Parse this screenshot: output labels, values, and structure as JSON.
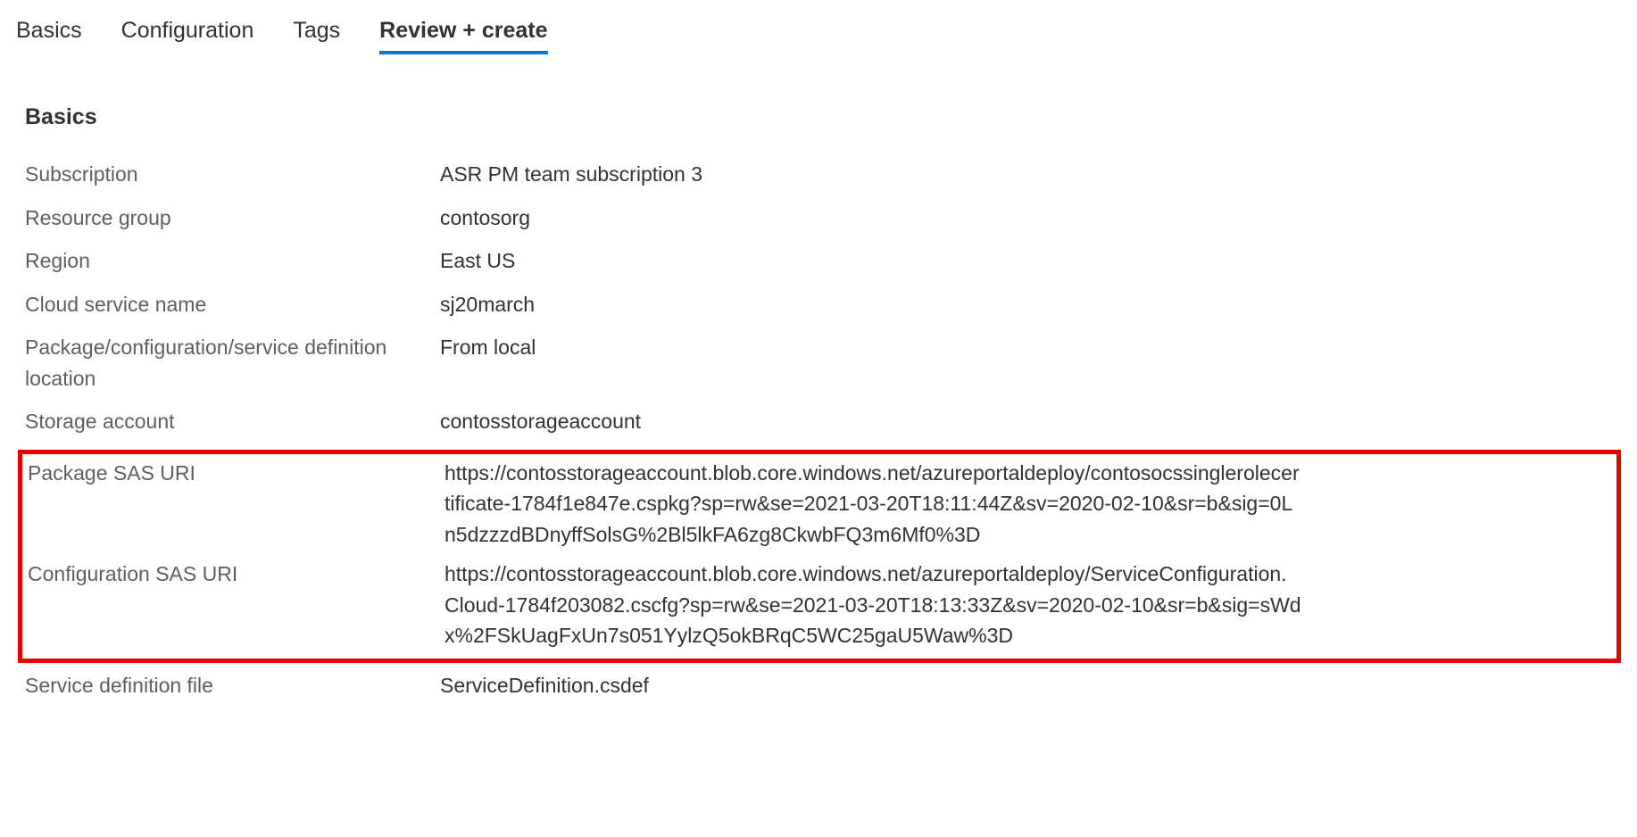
{
  "tabs": {
    "basics": "Basics",
    "configuration": "Configuration",
    "tags": "Tags",
    "review": "Review + create"
  },
  "section": {
    "title": "Basics"
  },
  "rows": {
    "subscription": {
      "label": "Subscription",
      "value": "ASR PM team subscription 3"
    },
    "resourceGroup": {
      "label": "Resource group",
      "value": "contosorg"
    },
    "region": {
      "label": "Region",
      "value": "East US"
    },
    "cloudServiceName": {
      "label": "Cloud service name",
      "value": "sj20march"
    },
    "packageLocation": {
      "label": "Package/configuration/service definition location",
      "value": "From local"
    },
    "storageAccount": {
      "label": "Storage account",
      "value": "contosstorageaccount"
    },
    "packageSasUri": {
      "label": "Package SAS URI",
      "value": "https://contosstorageaccount.blob.core.windows.net/azureportaldeploy/contosocssinglerolecertificate-1784f1e847e.cspkg?sp=rw&se=2021-03-20T18:11:44Z&sv=2020-02-10&sr=b&sig=0Ln5dzzzdBDnyffSolsG%2Bl5lkFA6zg8CkwbFQ3m6Mf0%3D"
    },
    "configSasUri": {
      "label": "Configuration SAS URI",
      "value": "https://contosstorageaccount.blob.core.windows.net/azureportaldeploy/ServiceConfiguration.Cloud-1784f203082.cscfg?sp=rw&se=2021-03-20T18:13:33Z&sv=2020-02-10&sr=b&sig=sWdx%2FSkUagFxUn7s051YylzQ5okBRqC5WC25gaU5Waw%3D"
    },
    "serviceDefFile": {
      "label": "Service definition file",
      "value": "ServiceDefinition.csdef"
    }
  }
}
